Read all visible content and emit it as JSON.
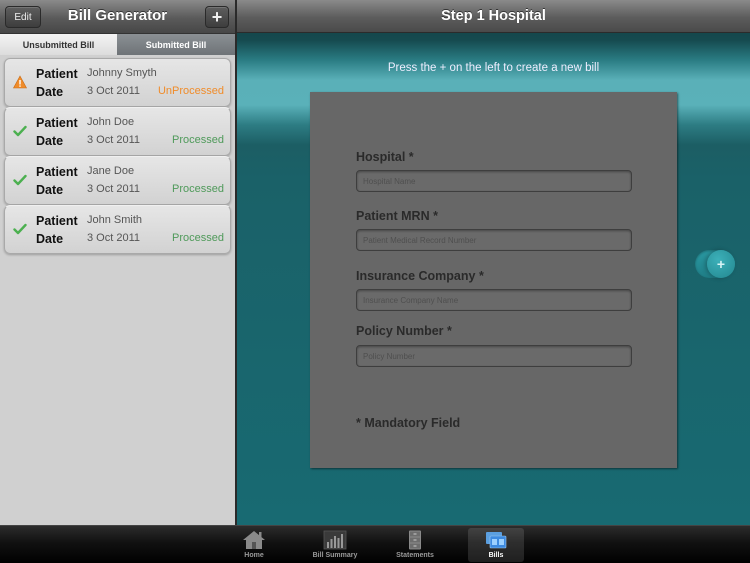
{
  "left_nav": {
    "title": "Bill Generator",
    "edit_label": "Edit",
    "add_label": "+"
  },
  "segments": {
    "unsubmitted": "Unsubmitted Bill",
    "submitted": "Submitted Bill",
    "selected": "Unsubmitted Bill"
  },
  "bills": [
    {
      "status_icon": "warning-icon",
      "patient_label": "Patient",
      "patient": "Johnny Smyth",
      "date_label": "Date",
      "date": "3 Oct 2011",
      "status": "UnProcessed",
      "status_color": "#f08c2a"
    },
    {
      "status_icon": "checkmark-icon",
      "patient_label": "Patient",
      "patient": "John Doe",
      "date_label": "Date",
      "date": "3 Oct 2011",
      "status": "Processed",
      "status_color": "#4f9a5a"
    },
    {
      "status_icon": "checkmark-icon",
      "patient_label": "Patient",
      "patient": "Jane Doe",
      "date_label": "Date",
      "date": "3 Oct 2011",
      "status": "Processed",
      "status_color": "#4f9a5a"
    },
    {
      "status_icon": "checkmark-icon",
      "patient_label": "Patient",
      "patient": "John Smith",
      "date_label": "Date",
      "date": "3 Oct 2011",
      "status": "Processed",
      "status_color": "#4f9a5a"
    }
  ],
  "right_nav": {
    "title": "Step 1 Hospital"
  },
  "hint": "Press the + on the left to create a new bill",
  "form": {
    "fields": [
      {
        "label": "Hospital *",
        "placeholder": "Hospital Name",
        "value": ""
      },
      {
        "label": "Patient MRN *",
        "placeholder": "Patient Medical Record Number",
        "value": ""
      },
      {
        "label": "Insurance Company *",
        "placeholder": "Insurance Company Name",
        "value": ""
      },
      {
        "label": "Policy Number *",
        "placeholder": "Policy Number",
        "value": ""
      }
    ],
    "mandatory_note": "* Mandatory Field"
  },
  "toggle": {
    "icon": "plus-icon",
    "label": "+"
  },
  "tabbar": {
    "tabs": [
      {
        "label": "Home",
        "icon": "home-icon",
        "selected": false
      },
      {
        "label": "Bill Summary",
        "icon": "bar-chart-icon",
        "selected": false
      },
      {
        "label": "Statements",
        "icon": "filing-cabinet-icon",
        "selected": false
      },
      {
        "label": "Bills",
        "icon": "bills-icon",
        "selected": true
      }
    ]
  },
  "colors": {
    "accent_teal": "#1a6a72",
    "unprocessed": "#f08c2a",
    "processed": "#4f9a5a"
  }
}
